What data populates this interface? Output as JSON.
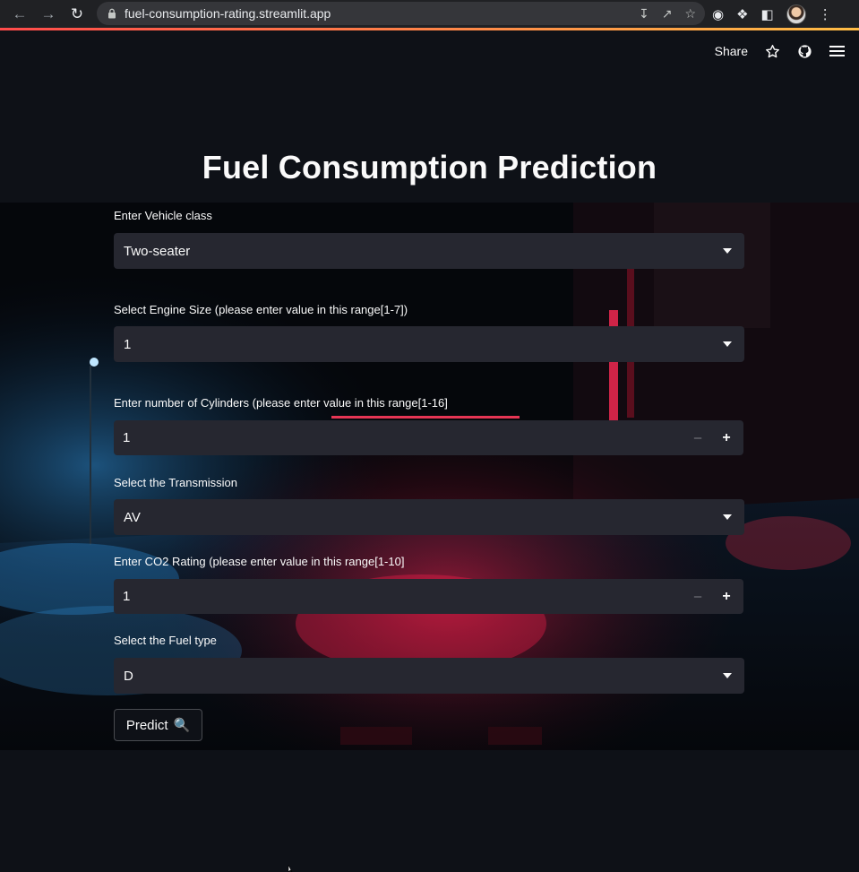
{
  "browser": {
    "url": "fuel-consumption-rating.streamlit.app"
  },
  "toolbar": {
    "share_label": "Share"
  },
  "page": {
    "title": "Fuel Consumption Prediction"
  },
  "form": {
    "vehicle_class": {
      "label": "Enter Vehicle class",
      "value": "Two-seater"
    },
    "engine_size": {
      "label": "Select Engine Size (please enter value in this range[1-7])",
      "value": "1"
    },
    "cylinders": {
      "label": "Enter number of Cylinders (please enter value in this range[1-16]",
      "value": "1"
    },
    "transmission": {
      "label": "Select the Transmission",
      "value": "AV"
    },
    "co2_rating": {
      "label": "Enter CO2 Rating (please enter value in this range[1-10]",
      "value": "1"
    },
    "fuel_type": {
      "label": "Select the Fuel type",
      "value": "D"
    },
    "predict_label": "Predict",
    "predict_emoji": "🔍"
  },
  "colors": {
    "background": "#0e1117",
    "widget": "#262730",
    "accent_red": "#ff4b4b",
    "accent_yellow": "#ffbd45"
  }
}
